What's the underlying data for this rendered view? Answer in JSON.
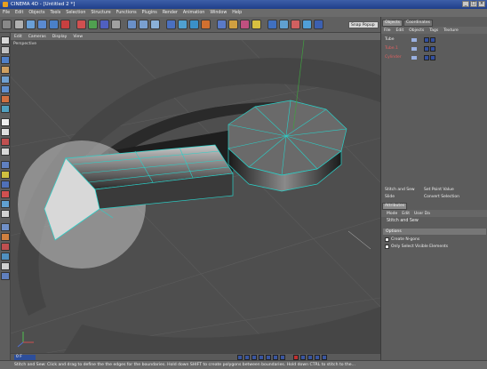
{
  "window": {
    "title": "CINEMA 4D - [Untitled 2 *]",
    "controls": [
      "_",
      "□",
      "×"
    ]
  },
  "menubar": [
    "File",
    "Edit",
    "Objects",
    "Tools",
    "Selection",
    "Structure",
    "Functions",
    "Plugins",
    "Render",
    "Animation",
    "Window",
    "Help"
  ],
  "toolbar": {
    "snap_popup": "Snap Popup"
  },
  "viewport": {
    "menu": [
      "Edit",
      "Cameras",
      "Display",
      "View"
    ],
    "label": "Perspective"
  },
  "timeline": {
    "frame": "0 F"
  },
  "status_text": "Stitch and Sew: Click and drag to define the the edges for the boundaries. Hold down SHIFT to create polygons between boundaries. Hold down CTRL to stitch to the...",
  "objects_panel": {
    "tabs": [
      "Objects",
      "Coordinates"
    ],
    "menu": [
      "File",
      "Edit",
      "Objects",
      "Tags",
      "Texture"
    ],
    "rows": [
      {
        "name": "Tube",
        "color": "#e8e8e8"
      },
      {
        "name": "Tube.1",
        "color": "#e06060"
      },
      {
        "name": "Cylinder",
        "color": "#e06060"
      }
    ]
  },
  "info": {
    "left": [
      "Stitch and Sew",
      "Slide"
    ],
    "right": [
      "Set Point Value",
      "Convert Selection"
    ]
  },
  "attributes": {
    "tab": "Attributes",
    "menu": [
      "Mode",
      "Edit",
      "User Da"
    ],
    "tool_name": "Stitch and Sew",
    "section": "Options",
    "options": [
      "Create N-gons",
      "Only Select Visible Elements"
    ]
  },
  "colors": {
    "wire": "#2ad0c8",
    "accent": "#2d4e9a"
  }
}
